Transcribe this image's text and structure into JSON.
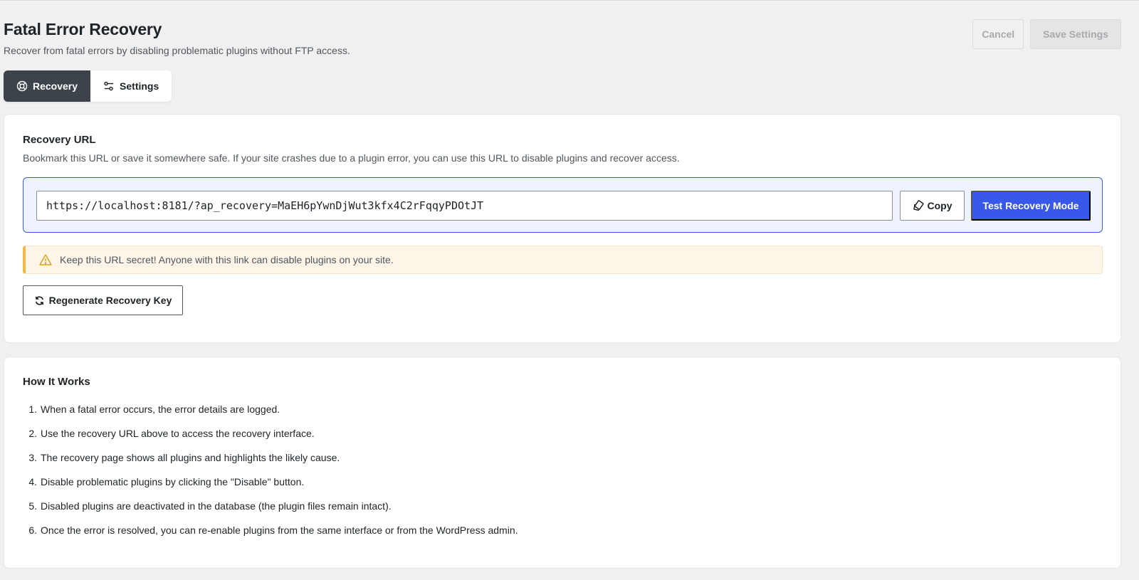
{
  "header": {
    "title": "Fatal Error Recovery",
    "subtitle": "Recover from fatal errors by disabling problematic plugins without FTP access.",
    "cancel_label": "Cancel",
    "save_label": "Save Settings"
  },
  "tabs": [
    {
      "label": "Recovery",
      "icon": "lifebuoy-icon",
      "active": true
    },
    {
      "label": "Settings",
      "icon": "sliders-icon",
      "active": false
    }
  ],
  "recovery": {
    "title": "Recovery URL",
    "description": "Bookmark this URL or save it somewhere safe. If your site crashes due to a plugin error, you can use this URL to disable plugins and recover access.",
    "url": "https://localhost:8181/?ap_recovery=MaEH6pYwnDjWut3kfx4C2rFqqyPDOtJT",
    "copy_label": "Copy",
    "test_label": "Test Recovery Mode",
    "warning": "Keep this URL secret! Anyone with this link can disable plugins on your site.",
    "regenerate_label": "Regenerate Recovery Key"
  },
  "how_it_works": {
    "title": "How It Works",
    "steps": [
      {
        "num": "1.",
        "text": "When a fatal error occurs, the error details are logged."
      },
      {
        "num": "2.",
        "text": "Use the recovery URL above to access the recovery interface."
      },
      {
        "num": "3.",
        "text": "The recovery page shows all plugins and highlights the likely cause."
      },
      {
        "num": "4.",
        "text": "Disable problematic plugins by clicking the \"Disable\" button."
      },
      {
        "num": "5.",
        "text": "Disabled plugins are deactivated in the database (the plugin files remain intact)."
      },
      {
        "num": "6.",
        "text": "Once the error is resolved, you can re-enable plugins from the same interface or from the WordPress admin."
      }
    ]
  },
  "colors": {
    "accent": "#3858e9",
    "tab_active": "#3c434a",
    "warning": "#f0b849"
  }
}
